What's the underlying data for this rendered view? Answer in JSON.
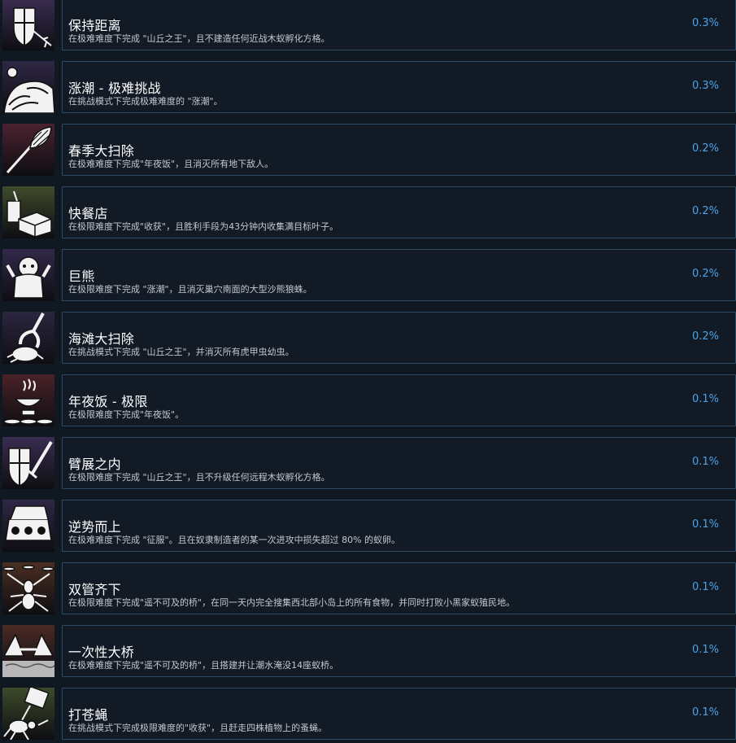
{
  "achievements": [
    {
      "title": "保持距离",
      "desc": "在极难难度下完成 \"山丘之王\"，且不建造任何近战木蚁孵化方格。",
      "percent": "0.3%",
      "icon": "shield-arrows-icon",
      "bg": "#3a2d52"
    },
    {
      "title": "涨潮 - 极难挑战",
      "desc": "在挑战模式下完成极难难度的 \"涨潮\"。",
      "percent": "0.3%",
      "icon": "wave-icon",
      "bg": "#2f2746"
    },
    {
      "title": "春季大扫除",
      "desc": "在极难难度下完成\"年夜饭\"，且消灭所有地下敌人。",
      "percent": "0.2%",
      "icon": "feather-duster-icon",
      "bg": "#4a2230"
    },
    {
      "title": "快餐店",
      "desc": "在极限难度下完成\"收获\"，且胜利手段为43分钟内收集满目标叶子。",
      "percent": "0.2%",
      "icon": "fast-food-icon",
      "bg": "#3f4a2c"
    },
    {
      "title": "巨熊",
      "desc": "在极限难度下完成 \"涨潮\"，且消灭巢穴南面的大型沙熊狼蛛。",
      "percent": "0.2%",
      "icon": "bear-icon",
      "bg": "#33284a"
    },
    {
      "title": "海滩大扫除",
      "desc": "在挑战模式下完成 \"山丘之王\"，并消灭所有虎甲虫幼虫。",
      "percent": "0.2%",
      "icon": "claw-grabber-icon",
      "bg": "#2c2640"
    },
    {
      "title": "年夜饭 - 极限",
      "desc": "在极限难度下完成\"年夜饭\"。",
      "percent": "0.1%",
      "icon": "dinner-bowl-icon",
      "bg": "#4a2228"
    },
    {
      "title": "臂展之内",
      "desc": "在极限难度下完成 \"山丘之王\"，且不升级任何远程木蚁孵化方格。",
      "percent": "0.1%",
      "icon": "shield-sword-icon",
      "bg": "#3a2d52"
    },
    {
      "title": "逆势而上",
      "desc": "在极难难度下完成 \"征服\"。且在奴隶制造者的某一次进攻中损失超过 80% 的蚁卵。",
      "percent": "0.1%",
      "icon": "egg-carton-icon",
      "bg": "#2f2746"
    },
    {
      "title": "双管齐下",
      "desc": "在极限难度下完成\"遥不可及的桥\"，在同一天内完全搜集西北部小岛上的所有食物，并同时打败小黑家蚁殖民地。",
      "percent": "0.1%",
      "icon": "ant-juggling-icon",
      "bg": "#4a2e22"
    },
    {
      "title": "一次性大桥",
      "desc": "在极难难度下完成\"遥不可及的桥\"，且搭建并让潮水淹没14座蚁桥。",
      "percent": "0.1%",
      "icon": "bridge-icon",
      "bg": "#4a2a24"
    },
    {
      "title": "打苍蝇",
      "desc": "在挑战模式下完成极限难度的\"收获\"，且赶走四株植物上的蚤蝇。",
      "percent": "0.1%",
      "icon": "ant-swatter-icon",
      "bg": "#3d4a2a"
    }
  ]
}
